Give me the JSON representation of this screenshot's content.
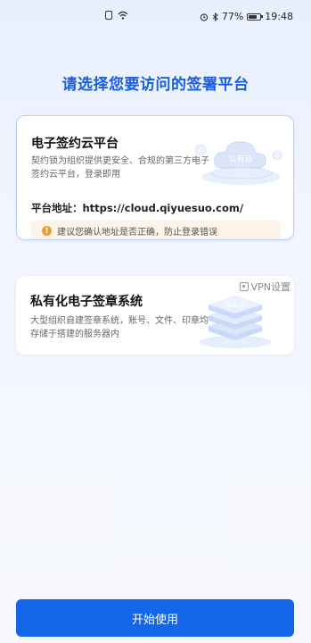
{
  "status_bar": {
    "battery": "77%",
    "time": "19:48"
  },
  "page_title": "请选择您要访问的签署平台",
  "cloud_card": {
    "title": "电子签约云平台",
    "description": "契约锁为组织提供更安全、合规的第三方电子签约云平台，登录即用",
    "illustration_label": "公有云",
    "address_label": "平台地址：",
    "address": "https://cloud.qiyuesuo.com/",
    "warning": "建议您确认地址是否正确，防止登录错误"
  },
  "private_card": {
    "title": "私有化电子签章系统",
    "description": "大型组织自建签章系统，账号、文件、印章均存储于搭建的服务器内",
    "illustration_label": "私有云",
    "vpn_label": "VPN设置"
  },
  "start_button": "开始使用",
  "colors": {
    "accent": "#1366e8",
    "title": "#1a5ee0",
    "warning_bg": "#fdf3e6",
    "warning_icon": "#f29b2c"
  }
}
